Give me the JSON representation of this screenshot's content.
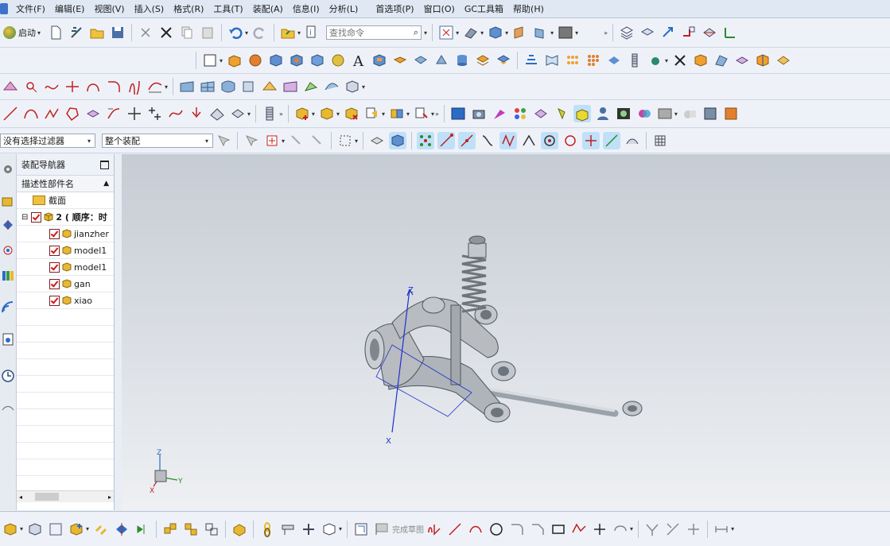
{
  "menu": {
    "items": [
      "文件(F)",
      "编辑(E)",
      "视图(V)",
      "插入(S)",
      "格式(R)",
      "工具(T)",
      "装配(A)",
      "信息(I)",
      "分析(L)",
      "首选项(P)",
      "窗口(O)",
      "GC工具箱",
      "帮助(H)"
    ]
  },
  "toolbar": {
    "start_label": "启动",
    "search_placeholder": "查找命令"
  },
  "filters": {
    "selection_filter": "没有选择过滤器",
    "scope": "整个装配"
  },
  "navigator": {
    "title": "装配导航器",
    "column_header": "描述性部件名",
    "section_node": "截面",
    "root_node": "2 ( 顺序：时",
    "components": [
      "jianzher",
      "model1",
      "model1",
      "gan",
      "xiao"
    ]
  },
  "viewport": {
    "axis_z": "Z",
    "axis_x": "X",
    "triad_z": "Z",
    "triad_y": "Y",
    "triad_x": "X"
  },
  "bottom_toolbar": {
    "finish_sketch": "完成草图"
  },
  "colors": {
    "accent": "#3a73c9",
    "check": "#d01818",
    "part": "#e8b832",
    "model": "#b8bcc0"
  }
}
